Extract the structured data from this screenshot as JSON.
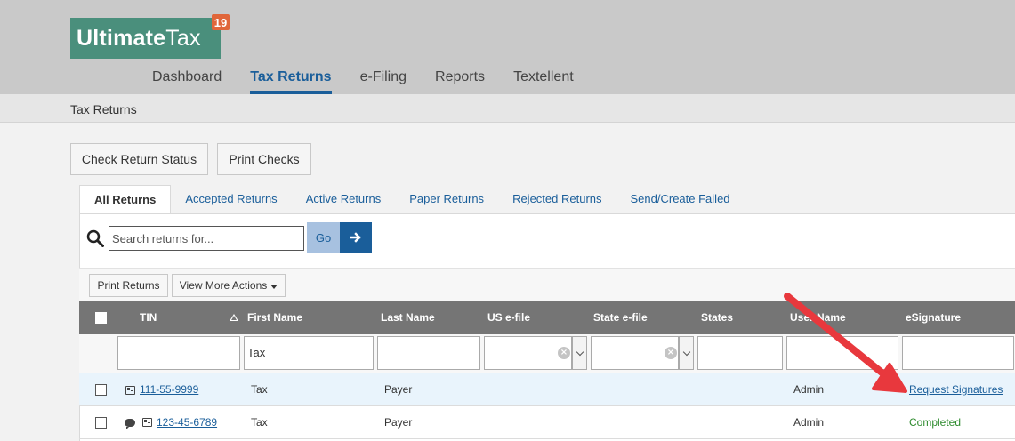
{
  "app": {
    "logo_bold": "Ultimate",
    "logo_light": "Tax",
    "logo_badge": "19"
  },
  "nav": {
    "items": [
      {
        "label": "Dashboard",
        "active": false
      },
      {
        "label": "Tax Returns",
        "active": true
      },
      {
        "label": "e-Filing",
        "active": false
      },
      {
        "label": "Reports",
        "active": false
      },
      {
        "label": "Textellent",
        "active": false
      }
    ]
  },
  "breadcrumb": {
    "current": "Tax Returns"
  },
  "actions": {
    "check_return_status": "Check Return Status",
    "print_checks": "Print Checks"
  },
  "tabs": [
    {
      "label": "All Returns",
      "active": true
    },
    {
      "label": "Accepted Returns",
      "active": false
    },
    {
      "label": "Active Returns",
      "active": false
    },
    {
      "label": "Paper Returns",
      "active": false
    },
    {
      "label": "Rejected Returns",
      "active": false
    },
    {
      "label": "Send/Create Failed",
      "active": false
    }
  ],
  "search": {
    "placeholder": "Search returns for...",
    "go_label": "Go"
  },
  "toolbar": {
    "print_returns": "Print Returns",
    "view_more_actions": "View More Actions"
  },
  "table": {
    "columns": [
      "TIN",
      "First Name",
      "Last Name",
      "US e-file",
      "State e-file",
      "States",
      "User Name",
      "eSignature"
    ],
    "filters": {
      "first_name": "Tax"
    },
    "rows": [
      {
        "tin": "111-55-9999",
        "first_name": "Tax",
        "last_name": "Payer",
        "us_efile": "",
        "state_efile": "",
        "states": "",
        "user_name": "Admin",
        "esignature": "Request Signatures",
        "icons": [
          "id-card-icon"
        ]
      },
      {
        "tin": "123-45-6789",
        "first_name": "Tax",
        "last_name": "Payer",
        "us_efile": "",
        "state_efile": "",
        "states": "",
        "user_name": "Admin",
        "esignature": "Completed",
        "icons": [
          "chat-icon",
          "id-card-icon"
        ]
      }
    ]
  },
  "colors": {
    "header_bg": "#c9c9c9",
    "logo_bg": "#4a8f7c",
    "badge": "#e0663a",
    "accent": "#1a5e9a",
    "table_header": "#757575",
    "row_highlight": "#e9f4fc",
    "completed": "#2e8b2e",
    "annotation_arrow": "#e8383d"
  }
}
